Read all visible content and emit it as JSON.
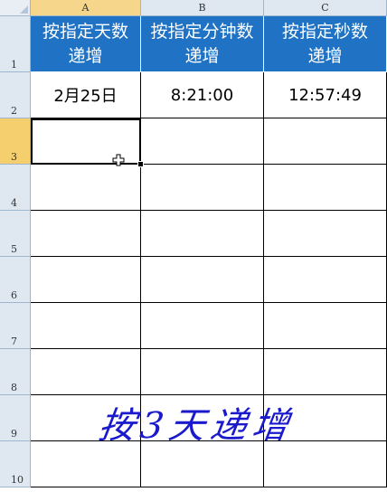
{
  "columns": [
    {
      "letter": "A",
      "header": "按指定天数递增",
      "value": "2月25日"
    },
    {
      "letter": "B",
      "header": "按指定分钟数递增",
      "value": "8:21:00"
    },
    {
      "letter": "C",
      "header": "按指定秒数递增",
      "value": "12:57:49"
    }
  ],
  "rows": [
    "1",
    "2",
    "3",
    "4",
    "5",
    "6",
    "7",
    "8",
    "9",
    "10"
  ],
  "active_cell": {
    "column": "A",
    "row": "3"
  },
  "annotation": "按3天递增",
  "colors": {
    "header_fill": "#1f72c4",
    "header_text": "#ffffff",
    "grid": "#000000",
    "annotation": "#1a1acc",
    "active_header": "#f5d68a"
  }
}
